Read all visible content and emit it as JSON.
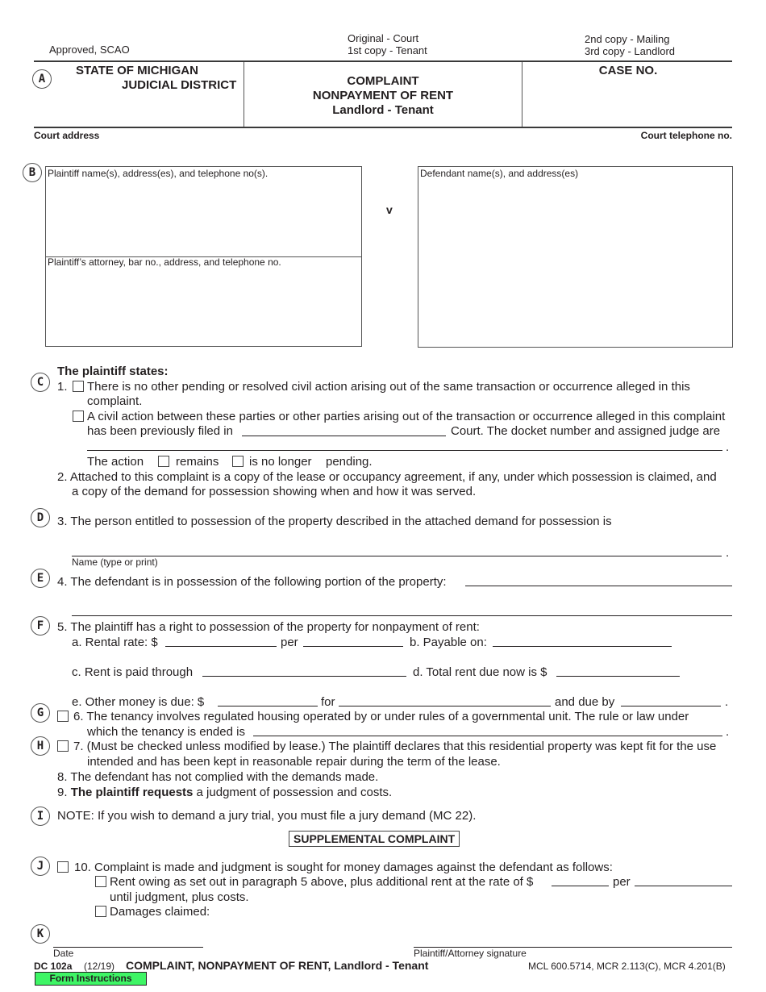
{
  "header": {
    "approved": "Approved, SCAO",
    "copies_center": [
      "Original - Court",
      "1st copy - Tenant"
    ],
    "copies_right": [
      "2nd copy - Mailing",
      "3rd copy - Landlord"
    ],
    "state": "STATE OF MICHIGAN",
    "district": "JUDICIAL DISTRICT",
    "title_lines": [
      "COMPLAINT",
      "NONPAYMENT OF RENT",
      "Landlord - Tenant"
    ],
    "case_no": "CASE NO.",
    "court_address": "Court address",
    "court_telephone": "Court telephone no."
  },
  "markers": [
    "A",
    "B",
    "C",
    "D",
    "E",
    "F",
    "G",
    "H",
    "I",
    "J",
    "K"
  ],
  "parties": {
    "plaintiff_label": "Plaintiff name(s), address(es), and telephone no(s).",
    "attorney_label": "Plaintiff’s attorney, bar no., address, and telephone no.",
    "versus": "v",
    "defendant_label": "Defendant name(s), and address(es)"
  },
  "statements": {
    "heading": "The plaintiff states:",
    "s1_num": "1.",
    "s1a_line1": "There is no other pending or resolved civil action arising out of the same transaction or occurrence alleged in this",
    "s1a_line2": "complaint.",
    "s1b_line1": "A civil action between these parties or other parties arising out of the transaction or occurrence alleged in this complaint",
    "s1b_line2_pre": "has been previously filed in",
    "s1b_line2_post": "Court.  The docket number and assigned judge are",
    "action_label": "The action",
    "remains": "remains",
    "no_longer": "is no longer",
    "pending": "pending.",
    "s2_line1": "2. Attached to this complaint is a copy of the lease or occupancy agreement, if any, under which possession is claimed, and",
    "s2_line2": "a copy of the demand for possession showing when and how it was served.",
    "s3": "3. The person entitled to possession of the property described in the attached demand for possession is",
    "name_caption": "Name (type or print)",
    "s4": "4. The defendant is in possession of the following portion of the property:",
    "s5": "5. The plaintiff has a right to possession of the property for nonpayment of rent:",
    "s5a": "a. Rental rate: $",
    "s5a_per": "per",
    "s5b": "b. Payable on:",
    "s5c": "c. Rent is paid through",
    "s5d": "d. Total rent due now is $",
    "s5e": "e. Other money is due:  $",
    "s5e_for": "for",
    "s5e_due": "and due by",
    "s6_line1": "6. The tenancy involves regulated housing operated by or under rules of a governmental unit.  The rule or law under",
    "s6_line2": "which the tenancy is ended is",
    "s7_line1": "7. (Must be checked unless modified by lease.)  The plaintiff declares that this residential property was kept fit for the use",
    "s7_line2": "intended and has been kept in reasonable repair during the term of the lease.",
    "s8": "8. The defendant has not complied with the demands made.",
    "s9_num": "9.",
    "s9_bold": "The plaintiff requests",
    "s9_rest": " a judgment of possession and costs.",
    "note": "NOTE:  If you wish to demand a jury trial, you must file a jury demand (MC 22)."
  },
  "supplemental": {
    "title": "SUPPLEMENTAL COMPLAINT",
    "s10": "10. Complaint is made and judgment is sought for money damages against the defendant as follows:",
    "rent_owing": "Rent owing as set out in paragraph 5 above, plus additional rent at the rate of $",
    "rent_per": "per",
    "until": "until judgment, plus costs.",
    "damages": "Damages claimed:"
  },
  "signature": {
    "date": "Date",
    "signature": "Plaintiff/Attorney signature"
  },
  "footer": {
    "form_no": "DC 102a",
    "revision": "(12/19)",
    "title": "COMPLAINT, NONPAYMENT OF RENT, Landlord - Tenant",
    "citation": "MCL 600.5714, MCR 2.113(C), MCR 4.201(B)",
    "instructions_button": "Form Instructions",
    "instructions_color": "#3ef565"
  }
}
